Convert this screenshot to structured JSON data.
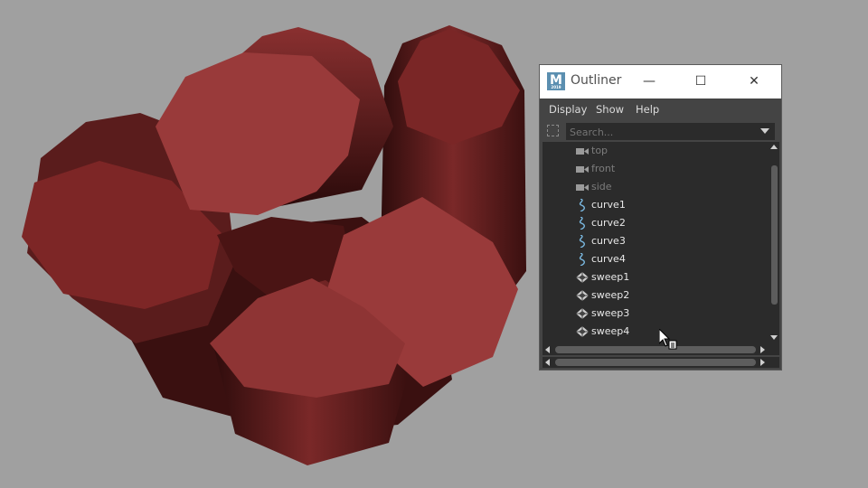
{
  "window": {
    "title": "Outliner",
    "logo_letter": "M",
    "logo_sub": "2019",
    "minimize_glyph": "—",
    "maximize_glyph": "☐",
    "close_glyph": "✕"
  },
  "menu": [
    "Display",
    "Show",
    "Help"
  ],
  "search": {
    "placeholder": "Search..."
  },
  "outliner_items": [
    {
      "label": "top",
      "icon": "camera-icon",
      "dimmed": true
    },
    {
      "label": "front",
      "icon": "camera-icon",
      "dimmed": true
    },
    {
      "label": "side",
      "icon": "camera-icon",
      "dimmed": true
    },
    {
      "label": "curve1",
      "icon": "curve-icon",
      "dimmed": false
    },
    {
      "label": "curve2",
      "icon": "curve-icon",
      "dimmed": false
    },
    {
      "label": "curve3",
      "icon": "curve-icon",
      "dimmed": false
    },
    {
      "label": "curve4",
      "icon": "curve-icon",
      "dimmed": false
    },
    {
      "label": "sweep1",
      "icon": "mesh-icon",
      "dimmed": false
    },
    {
      "label": "sweep2",
      "icon": "mesh-icon",
      "dimmed": false
    },
    {
      "label": "sweep3",
      "icon": "mesh-icon",
      "dimmed": false
    },
    {
      "label": "sweep4",
      "icon": "mesh-icon",
      "dimmed": false
    }
  ],
  "colors": {
    "viewport_bg": "#a0a0a0",
    "mesh_face": "#993a3a",
    "mesh_shadow": "#3a1010",
    "panel_bg": "#444444",
    "list_bg": "#2b2b2b",
    "curve_icon": "#7ab8e0"
  }
}
